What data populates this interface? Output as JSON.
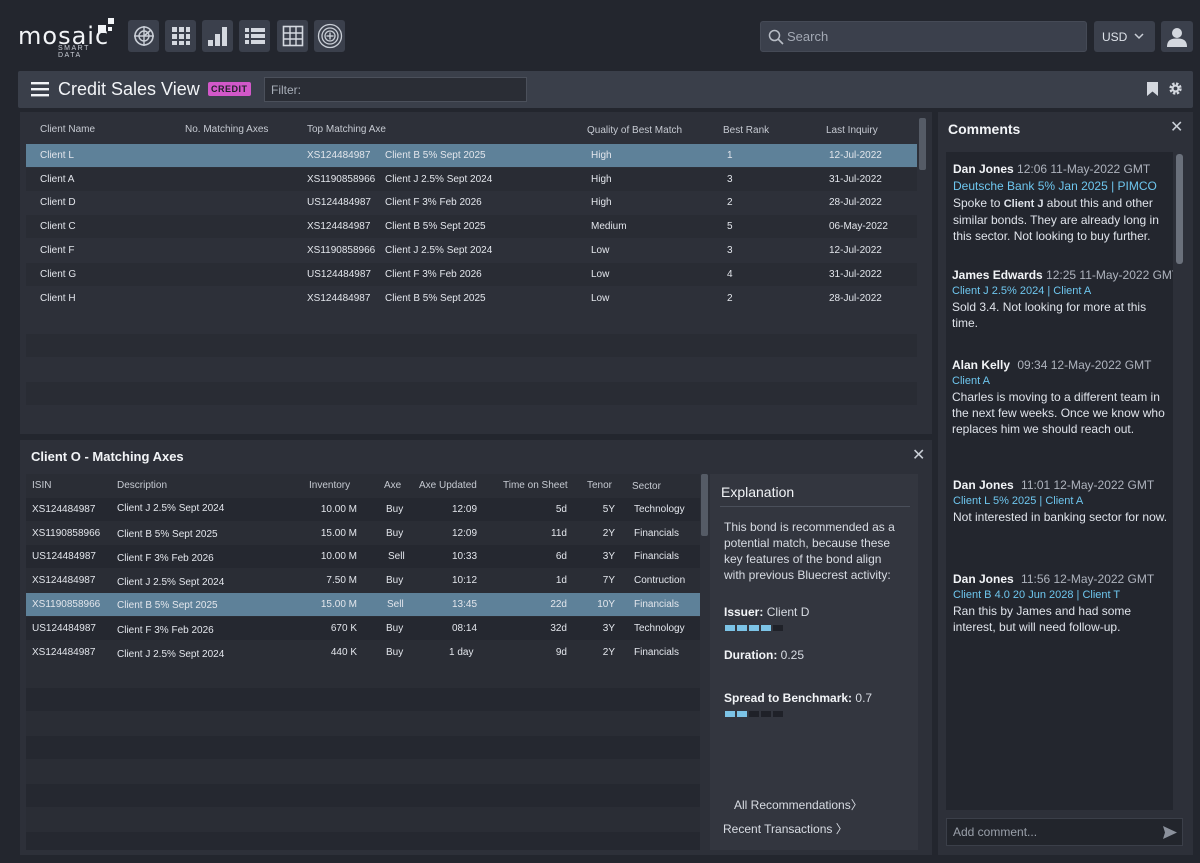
{
  "brand": {
    "name": "mosaic",
    "tagline": "SMART DATA"
  },
  "nav": [
    {
      "icon": "radar-icon"
    },
    {
      "icon": "grid-dots-icon"
    },
    {
      "icon": "bar-chart-icon"
    },
    {
      "icon": "list-icon"
    },
    {
      "icon": "table-icon"
    },
    {
      "icon": "target-plus-icon"
    }
  ],
  "search": {
    "placeholder": "Search"
  },
  "currency": {
    "value": "USD"
  },
  "view": {
    "title": "Credit Sales View",
    "badge": "CREDIT",
    "filter_label": "Filter:"
  },
  "main_table": {
    "headers": {
      "client": "Client Name",
      "matching": "No. Matching Axes",
      "top_axe": "Top Matching Axe",
      "quality": "Quality of Best Match",
      "rank": "Best Rank",
      "last": "Last Inquiry"
    },
    "rows": [
      {
        "client": "Client L",
        "isin": "XS124484987",
        "bond": "Client B 5% Sept 2025",
        "quality": "High",
        "rank": "1",
        "last": "12-Jul-2022"
      },
      {
        "client": "Client A",
        "isin": "XS1190858966",
        "bond": "Client J 2.5% Sept 2024",
        "quality": "High",
        "rank": "3",
        "last": "31-Jul-2022"
      },
      {
        "client": "Client D",
        "isin": "US124484987",
        "bond": "Client F 3% Feb 2026",
        "quality": "High",
        "rank": "2",
        "last": "28-Jul-2022"
      },
      {
        "client": "Client C",
        "isin": "XS124484987",
        "bond": "Client B 5% Sept 2025",
        "quality": "Medium",
        "rank": "5",
        "last": "06-May-2022"
      },
      {
        "client": "Client F",
        "isin": "XS1190858966",
        "bond": "Client J 2.5% Sept 2024",
        "quality": "Low",
        "rank": "3",
        "last": "12-Jul-2022"
      },
      {
        "client": "Client G",
        "isin": "US124484987",
        "bond": "Client F 3% Feb 2026",
        "quality": "Low",
        "rank": "4",
        "last": "31-Jul-2022"
      },
      {
        "client": "Client H",
        "isin": "XS124484987",
        "bond": "Client B 5% Sept 2025",
        "quality": "Low",
        "rank": "2",
        "last": "28-Jul-2022"
      }
    ]
  },
  "axes_panel": {
    "title": "Client O - Matching Axes",
    "headers": {
      "isin": "ISIN",
      "desc": "Description",
      "inventory": "Inventory",
      "axe": "Axe",
      "updated": "Axe Updated",
      "time": "Time on Sheet",
      "tenor": "Tenor",
      "sector": "Sector"
    },
    "rows": [
      {
        "isin": "XS124484987",
        "desc": "Client J 2.5% Sept 2024",
        "inventory": "10.00 M",
        "axe": "Buy",
        "updated": "12:09",
        "time": "5d",
        "tenor": "5Y",
        "sector": "Technology"
      },
      {
        "isin": "XS1190858966",
        "desc": "Client B 5% Sept 2025",
        "inventory": "15.00 M",
        "axe": "Buy",
        "updated": "12:09",
        "time": "11d",
        "tenor": "2Y",
        "sector": "Financials"
      },
      {
        "isin": "US124484987",
        "desc": "Client F 3% Feb 2026",
        "inventory": "10.00 M",
        "axe": "Sell",
        "updated": "10:33",
        "time": "6d",
        "tenor": "3Y",
        "sector": "Financials"
      },
      {
        "isin": "XS124484987",
        "desc": "Client J 2.5% Sept 2024",
        "inventory": "7.50 M",
        "axe": "Buy",
        "updated": "10:12",
        "time": "1d",
        "tenor": "7Y",
        "sector": "Contruction"
      },
      {
        "isin": "XS1190858966",
        "desc": "Client B 5% Sept 2025",
        "inventory": "15.00 M",
        "axe": "Sell",
        "updated": "13:45",
        "time": "22d",
        "tenor": "10Y",
        "sector": "Financials"
      },
      {
        "isin": "US124484987",
        "desc": "Client F 3% Feb 2026",
        "inventory": "670 K",
        "axe": "Buy",
        "updated": "08:14",
        "time": "32d",
        "tenor": "3Y",
        "sector": "Technology"
      },
      {
        "isin": "XS124484987",
        "desc": "Client J 2.5% Sept 2024",
        "inventory": "440 K",
        "axe": "Buy",
        "updated": "1 day",
        "time": "9d",
        "tenor": "2Y",
        "sector": "Financials"
      }
    ]
  },
  "explanation": {
    "title": "Explanation",
    "body": "This bond is recommended as a potential match, because these key features of the bond align with previous Bluecrest activity:",
    "features": [
      {
        "label": "Issuer:",
        "value": "Client D",
        "level": 4
      },
      {
        "label": "Duration:",
        "value": "0.25",
        "level": 0
      },
      {
        "label": "Spread to Benchmark:",
        "value": "0.7",
        "level": 2
      }
    ],
    "all_recs": "All Recommendations",
    "recent": "Recent Transactions"
  },
  "comments": {
    "title": "Comments",
    "items": [
      {
        "author": "Dan Jones",
        "time": "12:06 11-May-2022 GMT",
        "ref": "Deutsche Bank 5% Jan 2025 | PIMCO",
        "text_pre": "Spoke to ",
        "text_mid": "Client J",
        "text_post": " about this and other similar bonds. They are already long in this sector. Not looking to buy further."
      },
      {
        "author": "James Edwards",
        "time": "12:25 11-May-2022 GMT",
        "ref": "Client J 2.5% 2024 | Client A",
        "text": "Sold 3.4. Not looking for more at this time."
      },
      {
        "author": "Alan Kelly",
        "time": "09:34 12-May-2022 GMT",
        "ref": "Client A",
        "text": "Charles is moving to a different team in the next few weeks. Once we know who replaces him we should reach out."
      },
      {
        "author": "Dan Jones",
        "time": "11:01 12-May-2022 GMT",
        "ref": "Client L  5% 2025 | Client A",
        "text": "Not interested in banking sector for now."
      },
      {
        "author": "Dan Jones",
        "time": "11:56 12-May-2022 GMT",
        "ref": "Client B 4.0 20 Jun 2028 | Client T",
        "text": "Ran this by James and had some interest, but will need follow-up."
      }
    ],
    "add_placeholder": "Add comment..."
  }
}
